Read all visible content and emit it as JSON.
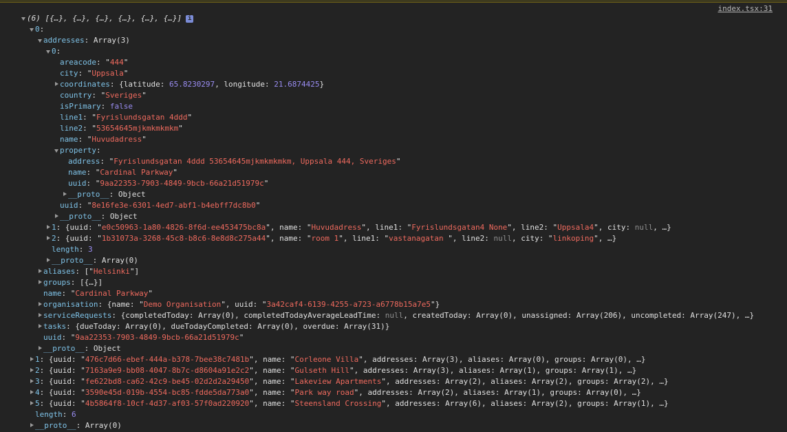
{
  "source_link": "index.tsx:31",
  "colors": {
    "background": "#232323",
    "key": "#7fc3e8",
    "string": "#ef6a5e",
    "number": "#9a8df2",
    "null": "#8e8e8e"
  },
  "lines": [
    {
      "indent": 0,
      "arrow": "open",
      "parts": [
        [
          "it",
          "(6) [{…}, {…}, {…}, {…}, {…}, {…}]"
        ]
      ],
      "info": "i"
    },
    {
      "indent": 1,
      "arrow": "open",
      "parts": [
        [
          "k",
          "0"
        ],
        [
          "p",
          ":"
        ]
      ]
    },
    {
      "indent": 2,
      "arrow": "open",
      "parts": [
        [
          "k",
          "addresses"
        ],
        [
          "p",
          ": Array(3)"
        ]
      ]
    },
    {
      "indent": 3,
      "arrow": "open",
      "parts": [
        [
          "k",
          "0"
        ],
        [
          "p",
          ":"
        ]
      ]
    },
    {
      "indent": 4,
      "arrow": "none",
      "parts": [
        [
          "k",
          "areacode"
        ],
        [
          "p",
          ": \""
        ],
        [
          "s",
          "444"
        ],
        [
          "p",
          "\""
        ]
      ]
    },
    {
      "indent": 4,
      "arrow": "none",
      "parts": [
        [
          "k",
          "city"
        ],
        [
          "p",
          ": \""
        ],
        [
          "s",
          "Uppsala"
        ],
        [
          "p",
          "\""
        ]
      ]
    },
    {
      "indent": 4,
      "arrow": "closed",
      "parts": [
        [
          "k",
          "coordinates"
        ],
        [
          "p",
          ": {latitude: "
        ],
        [
          "n",
          "65.8230297"
        ],
        [
          "p",
          ", longitude: "
        ],
        [
          "n",
          "21.6874425"
        ],
        [
          "p",
          "}"
        ]
      ]
    },
    {
      "indent": 4,
      "arrow": "none",
      "parts": [
        [
          "k",
          "country"
        ],
        [
          "p",
          ": \""
        ],
        [
          "s",
          "Sveriges"
        ],
        [
          "p",
          "\""
        ]
      ]
    },
    {
      "indent": 4,
      "arrow": "none",
      "parts": [
        [
          "k",
          "isPrimary"
        ],
        [
          "p",
          ": "
        ],
        [
          "n",
          "false"
        ]
      ]
    },
    {
      "indent": 4,
      "arrow": "none",
      "parts": [
        [
          "k",
          "line1"
        ],
        [
          "p",
          ": \""
        ],
        [
          "s",
          "Fyrislundsgatan 4ddd"
        ],
        [
          "p",
          "\""
        ]
      ]
    },
    {
      "indent": 4,
      "arrow": "none",
      "parts": [
        [
          "k",
          "line2"
        ],
        [
          "p",
          ": \""
        ],
        [
          "s",
          "53654645mjkmkmkmkm"
        ],
        [
          "p",
          "\""
        ]
      ]
    },
    {
      "indent": 4,
      "arrow": "none",
      "parts": [
        [
          "k",
          "name"
        ],
        [
          "p",
          ": \""
        ],
        [
          "s",
          "Huvudadress"
        ],
        [
          "p",
          "\""
        ]
      ]
    },
    {
      "indent": 4,
      "arrow": "open",
      "parts": [
        [
          "k",
          "property"
        ],
        [
          "p",
          ":"
        ]
      ]
    },
    {
      "indent": 5,
      "arrow": "none",
      "parts": [
        [
          "k",
          "address"
        ],
        [
          "p",
          ": \""
        ],
        [
          "s",
          "Fyrislundsgatan 4ddd 53654645mjkmkmkmkm, Uppsala 444, Sveriges"
        ],
        [
          "p",
          "\""
        ]
      ]
    },
    {
      "indent": 5,
      "arrow": "none",
      "parts": [
        [
          "k",
          "name"
        ],
        [
          "p",
          ": \""
        ],
        [
          "s",
          "Cardinal Parkway"
        ],
        [
          "p",
          "\""
        ]
      ]
    },
    {
      "indent": 5,
      "arrow": "none",
      "parts": [
        [
          "k",
          "uuid"
        ],
        [
          "p",
          ": \""
        ],
        [
          "s",
          "9aa22353-7903-4849-9bcb-66a21d51979c"
        ],
        [
          "p",
          "\""
        ]
      ]
    },
    {
      "indent": 5,
      "arrow": "closed",
      "parts": [
        [
          "k",
          "__proto__"
        ],
        [
          "p",
          ": Object"
        ]
      ]
    },
    {
      "indent": 4,
      "arrow": "none",
      "parts": [
        [
          "k",
          "uuid"
        ],
        [
          "p",
          ": \""
        ],
        [
          "s",
          "8e16fe3e-6301-4ed7-abf1-b4ebff7dc8b0"
        ],
        [
          "p",
          "\""
        ]
      ]
    },
    {
      "indent": 4,
      "arrow": "closed",
      "parts": [
        [
          "k",
          "__proto__"
        ],
        [
          "p",
          ": Object"
        ]
      ]
    },
    {
      "indent": 3,
      "arrow": "closed",
      "parts": [
        [
          "k",
          "1"
        ],
        [
          "p",
          ": {uuid: \""
        ],
        [
          "s",
          "e0c50963-1a80-4826-8f6d-ee453475bc8a"
        ],
        [
          "p",
          "\", name: \""
        ],
        [
          "s",
          "Huvudadress"
        ],
        [
          "p",
          "\", line1: \""
        ],
        [
          "s",
          "Fyrislundsgatan4 None"
        ],
        [
          "p",
          "\", line2: \""
        ],
        [
          "s",
          "Uppsala4"
        ],
        [
          "p",
          "\", city: "
        ],
        [
          "u",
          "null"
        ],
        [
          "p",
          ", …}"
        ]
      ]
    },
    {
      "indent": 3,
      "arrow": "closed",
      "parts": [
        [
          "k",
          "2"
        ],
        [
          "p",
          ": {uuid: \""
        ],
        [
          "s",
          "1b31073a-3268-45c8-b8c6-8e8d8c275a44"
        ],
        [
          "p",
          "\", name: \""
        ],
        [
          "s",
          "room 1"
        ],
        [
          "p",
          "\", line1: \""
        ],
        [
          "s",
          "vastanagatan "
        ],
        [
          "p",
          "\", line2: "
        ],
        [
          "u",
          "null"
        ],
        [
          "p",
          ", city: \""
        ],
        [
          "s",
          "linkoping"
        ],
        [
          "p",
          "\", …}"
        ]
      ]
    },
    {
      "indent": 3,
      "arrow": "none",
      "parts": [
        [
          "kp",
          "length"
        ],
        [
          "p",
          ": "
        ],
        [
          "n",
          "3"
        ]
      ]
    },
    {
      "indent": 3,
      "arrow": "closed",
      "parts": [
        [
          "kp",
          "__proto__"
        ],
        [
          "p",
          ": Array(0)"
        ]
      ]
    },
    {
      "indent": 2,
      "arrow": "closed",
      "parts": [
        [
          "k",
          "aliases"
        ],
        [
          "p",
          ": [\""
        ],
        [
          "s",
          "Helsinki"
        ],
        [
          "p",
          "\"]"
        ]
      ]
    },
    {
      "indent": 2,
      "arrow": "closed",
      "parts": [
        [
          "k",
          "groups"
        ],
        [
          "p",
          ": [{…}]"
        ]
      ]
    },
    {
      "indent": 2,
      "arrow": "none",
      "parts": [
        [
          "k",
          "name"
        ],
        [
          "p",
          ": \""
        ],
        [
          "s",
          "Cardinal Parkway"
        ],
        [
          "p",
          "\""
        ]
      ]
    },
    {
      "indent": 2,
      "arrow": "closed",
      "parts": [
        [
          "k",
          "organisation"
        ],
        [
          "p",
          ": {name: \""
        ],
        [
          "s",
          "Demo Organisation"
        ],
        [
          "p",
          "\", uuid: \""
        ],
        [
          "s",
          "3a42caf4-6139-4255-a723-a6778b15a7e5"
        ],
        [
          "p",
          "\"}"
        ]
      ]
    },
    {
      "indent": 2,
      "arrow": "closed",
      "parts": [
        [
          "k",
          "serviceRequests"
        ],
        [
          "p",
          ": {completedToday: Array(0), completedTodayAverageLeadTime: "
        ],
        [
          "u",
          "null"
        ],
        [
          "p",
          ", createdToday: Array(0), unassigned: Array(206), uncompleted: Array(247), …}"
        ]
      ]
    },
    {
      "indent": 2,
      "arrow": "closed",
      "parts": [
        [
          "k",
          "tasks"
        ],
        [
          "p",
          ": {dueToday: Array(0), dueTodayCompleted: Array(0), overdue: Array(31)}"
        ]
      ]
    },
    {
      "indent": 2,
      "arrow": "none",
      "parts": [
        [
          "k",
          "uuid"
        ],
        [
          "p",
          ": \""
        ],
        [
          "s",
          "9aa22353-7903-4849-9bcb-66a21d51979c"
        ],
        [
          "p",
          "\""
        ]
      ]
    },
    {
      "indent": 2,
      "arrow": "closed",
      "parts": [
        [
          "kp",
          "__proto__"
        ],
        [
          "p",
          ": Object"
        ]
      ]
    },
    {
      "indent": 1,
      "arrow": "closed",
      "parts": [
        [
          "k",
          "1"
        ],
        [
          "p",
          ": {uuid: \""
        ],
        [
          "s",
          "476c7d66-ebef-444a-b378-7bee38c7481b"
        ],
        [
          "p",
          "\", name: \""
        ],
        [
          "s",
          "Corleone Villa"
        ],
        [
          "p",
          "\", addresses: Array(3), aliases: Array(0), groups: Array(0), …}"
        ]
      ]
    },
    {
      "indent": 1,
      "arrow": "closed",
      "parts": [
        [
          "k",
          "2"
        ],
        [
          "p",
          ": {uuid: \""
        ],
        [
          "s",
          "7163a9e9-bb08-4047-8b7c-d8604a91e2c2"
        ],
        [
          "p",
          "\", name: \""
        ],
        [
          "s",
          "Gulseth Hill"
        ],
        [
          "p",
          "\", addresses: Array(3), aliases: Array(1), groups: Array(1), …}"
        ]
      ]
    },
    {
      "indent": 1,
      "arrow": "closed",
      "parts": [
        [
          "k",
          "3"
        ],
        [
          "p",
          ": {uuid: \""
        ],
        [
          "s",
          "fe622bd8-ca62-42c9-be45-02d2d2a29450"
        ],
        [
          "p",
          "\", name: \""
        ],
        [
          "s",
          "Lakeview Apartments"
        ],
        [
          "p",
          "\", addresses: Array(2), aliases: Array(2), groups: Array(2), …}"
        ]
      ]
    },
    {
      "indent": 1,
      "arrow": "closed",
      "parts": [
        [
          "k",
          "4"
        ],
        [
          "p",
          ": {uuid: \""
        ],
        [
          "s",
          "3590e45d-019b-4554-bc85-fdde5da773a0"
        ],
        [
          "p",
          "\", name: \""
        ],
        [
          "s",
          "Park way road"
        ],
        [
          "p",
          "\", addresses: Array(2), aliases: Array(1), groups: Array(0), …}"
        ]
      ]
    },
    {
      "indent": 1,
      "arrow": "closed",
      "parts": [
        [
          "k",
          "5"
        ],
        [
          "p",
          ": {uuid: \""
        ],
        [
          "s",
          "4b5864f8-10cf-4d37-af03-57f0ad220920"
        ],
        [
          "p",
          "\", name: \""
        ],
        [
          "s",
          "Steensland Crossing"
        ],
        [
          "p",
          "\", addresses: Array(6), aliases: Array(2), groups: Array(1), …}"
        ]
      ]
    },
    {
      "indent": 1,
      "arrow": "none",
      "parts": [
        [
          "kp",
          "length"
        ],
        [
          "p",
          ": "
        ],
        [
          "n",
          "6"
        ]
      ]
    },
    {
      "indent": 1,
      "arrow": "closed",
      "parts": [
        [
          "kp",
          "__proto__"
        ],
        [
          "p",
          ": Array(0)"
        ]
      ]
    }
  ]
}
